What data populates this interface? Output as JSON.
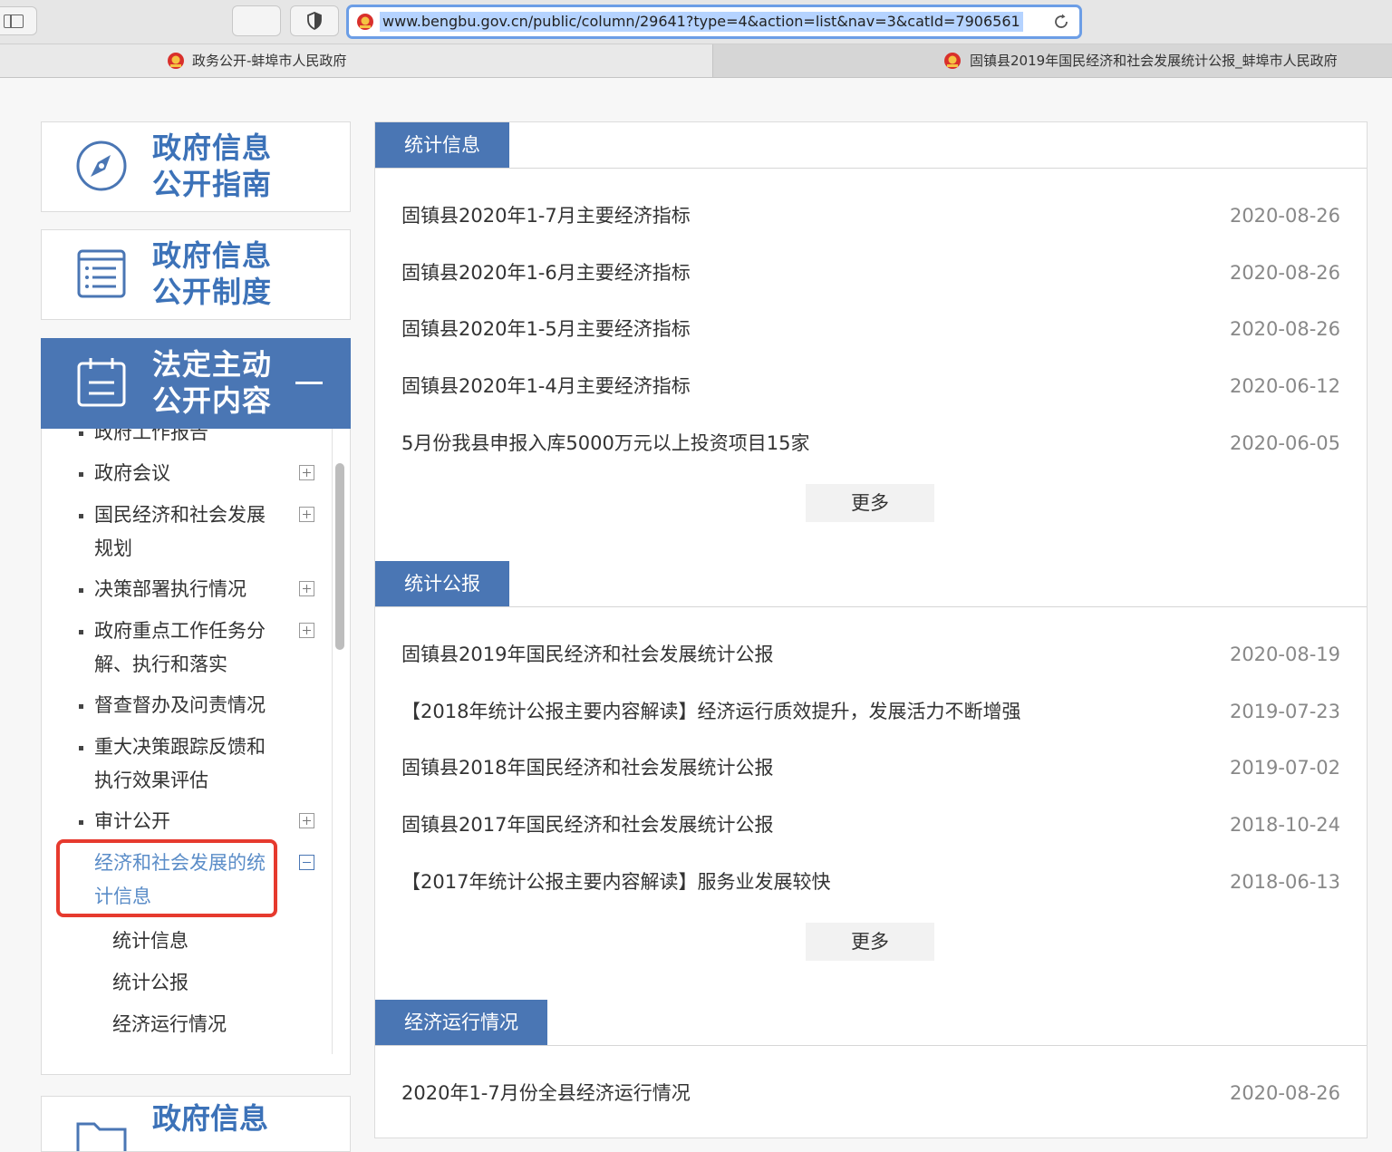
{
  "browser": {
    "url": "www.bengbu.gov.cn/public/column/29641?type=4&action=list&nav=3&catId=7906561",
    "tabs": [
      {
        "title": "政务公开-蚌埠市人民政府"
      },
      {
        "title": "固镇县2019年国民经济和社会发展统计公报_蚌埠市人民政府"
      }
    ]
  },
  "sidebar": {
    "guide": {
      "line1": "政府信息",
      "line2": "公开指南"
    },
    "system": {
      "line1": "政府信息",
      "line2": "公开制度"
    },
    "content": {
      "line1": "法定主动",
      "line2": "公开内容"
    },
    "tree": [
      {
        "label": "政府工作报告"
      },
      {
        "label": "政府会议"
      },
      {
        "label": "国民经济和社会发展规划"
      },
      {
        "label": "决策部署执行情况"
      },
      {
        "label": "政府重点工作任务分解、执行和落实"
      },
      {
        "label": "督查督办及问责情况"
      },
      {
        "label": "重大决策跟踪反馈和执行效果评估"
      },
      {
        "label": "审计公开"
      },
      {
        "label": "经济和社会发展的统计信息"
      }
    ],
    "sub_items": [
      "统计信息",
      "统计公报",
      "经济运行情况"
    ],
    "bottom_card": {
      "line1": "政府信息"
    }
  },
  "sections": [
    {
      "title": "统计信息",
      "more": "更多",
      "rows": [
        {
          "title": "固镇县2020年1-7月主要经济指标",
          "date": "2020-08-26"
        },
        {
          "title": "固镇县2020年1-6月主要经济指标",
          "date": "2020-08-26"
        },
        {
          "title": "固镇县2020年1-5月主要经济指标",
          "date": "2020-08-26"
        },
        {
          "title": "固镇县2020年1-4月主要经济指标",
          "date": "2020-06-12"
        },
        {
          "title": "5月份我县申报入库5000万元以上投资项目15家",
          "date": "2020-06-05"
        }
      ]
    },
    {
      "title": "统计公报",
      "more": "更多",
      "rows": [
        {
          "title": "固镇县2019年国民经济和社会发展统计公报",
          "date": "2020-08-19"
        },
        {
          "title": "【2018年统计公报主要内容解读】经济运行质效提升，发展活力不断增强",
          "date": "2019-07-23"
        },
        {
          "title": "固镇县2018年国民经济和社会发展统计公报",
          "date": "2019-07-02"
        },
        {
          "title": "固镇县2017年国民经济和社会发展统计公报",
          "date": "2018-10-24"
        },
        {
          "title": "【2017年统计公报主要内容解读】服务业发展较快",
          "date": "2018-06-13"
        }
      ]
    },
    {
      "title": "经济运行情况",
      "rows": [
        {
          "title": "2020年1-7月份全县经济运行情况",
          "date": "2020-08-26"
        }
      ]
    }
  ]
}
